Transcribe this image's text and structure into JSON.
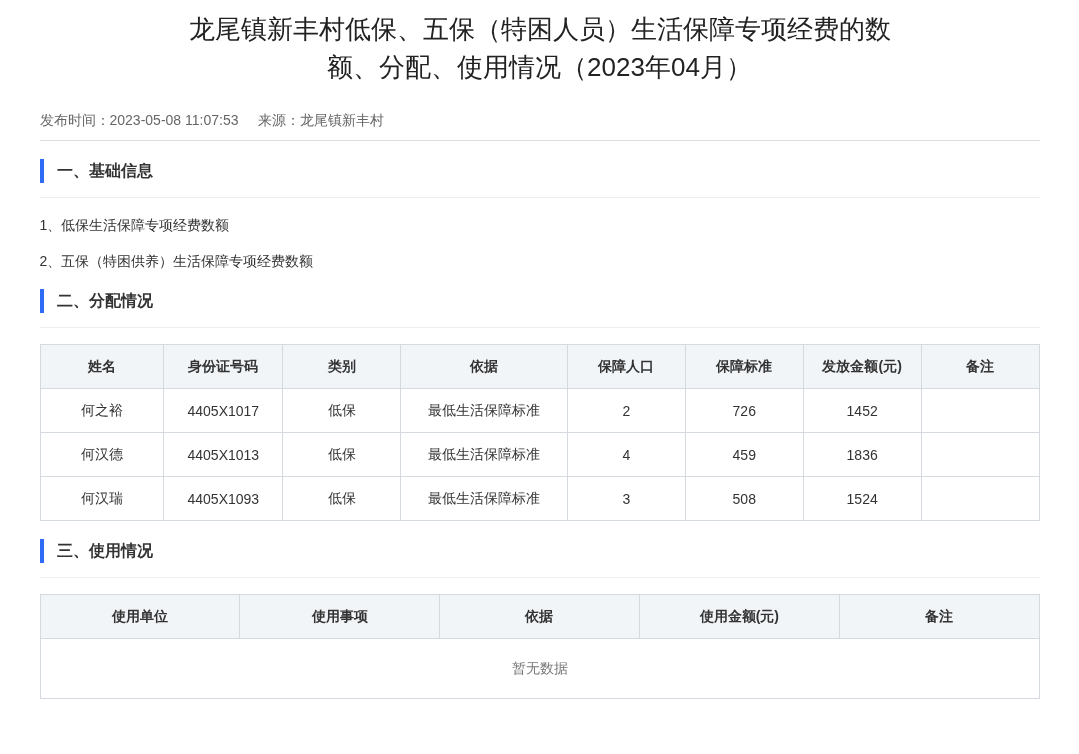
{
  "article": {
    "title": "龙尾镇新丰村低保、五保（特困人员）生活保障专项经费的数额、分配、使用情况（2023年04月）",
    "meta": [
      "发布时间：2023-05-08 11:07:53",
      "来源：龙尾镇新丰村"
    ]
  },
  "sections": [
    {
      "kind": "list",
      "heading": "一、基础信息",
      "items": [
        "1、低保生活保障专项经费数额",
        "2、五保（特困供养）生活保障专项经费数额"
      ]
    },
    {
      "kind": "table",
      "heading": "二、分配情况",
      "table": {
        "columns": [
          "姓名",
          "身份证号码",
          "类别",
          "依据",
          "保障人口",
          "保障标准",
          "发放金额(元)",
          "备注"
        ],
        "rows": [
          [
            "何之裕",
            "4405X1017",
            "低保",
            "最低生活保障标准",
            "2",
            "726",
            "1452"
          ],
          [
            "何汉德",
            "4405X1013",
            "低保",
            "最低生活保障标准",
            "4",
            "459",
            "1836"
          ],
          [
            "何汉瑞",
            "4405X1093",
            "低保",
            "最低生活保障标准",
            "3",
            "508",
            "1524"
          ]
        ]
      }
    },
    {
      "kind": "table",
      "heading": "三、使用情况",
      "table": {
        "columns": [
          "使用单位",
          "使用事项",
          "依据",
          "使用金额(元)",
          "备注"
        ],
        "empty_text": "暂无数据"
      }
    }
  ]
}
